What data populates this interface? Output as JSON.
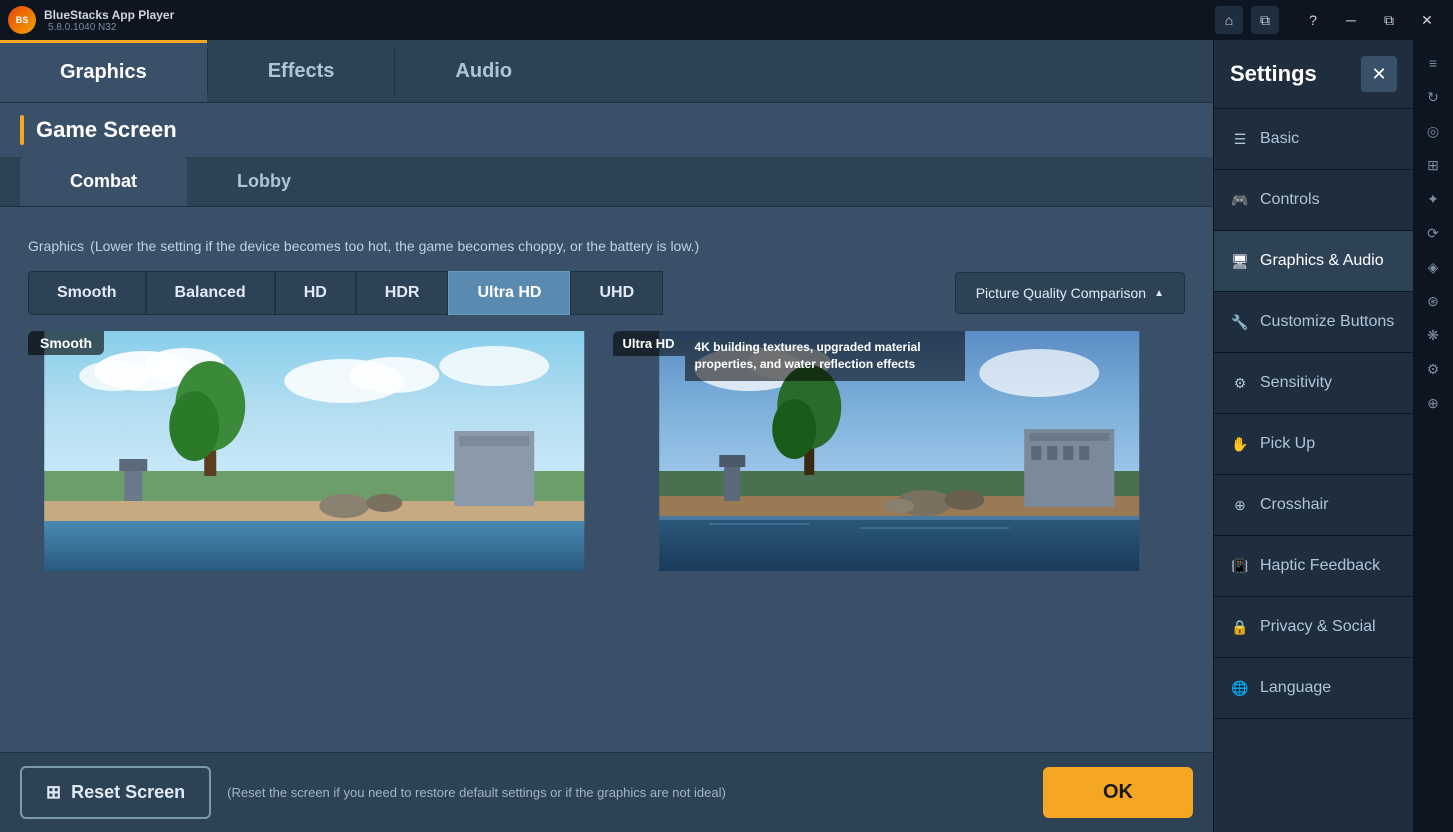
{
  "titlebar": {
    "app_name": "BlueStacks App Player",
    "version": "5.8.0.1040  N32",
    "logo_text": "BS"
  },
  "tabs": {
    "items": [
      {
        "label": "Graphics",
        "active": true
      },
      {
        "label": "Effects",
        "active": false
      },
      {
        "label": "Audio",
        "active": false
      }
    ]
  },
  "section": {
    "title": "Game Screen"
  },
  "sub_tabs": {
    "items": [
      {
        "label": "Combat",
        "active": true
      },
      {
        "label": "Lobby",
        "active": false
      }
    ]
  },
  "graphics": {
    "label": "Graphics",
    "description": "(Lower the setting if the device becomes too hot, the game becomes choppy, or the battery is low.)",
    "quality_buttons": [
      {
        "label": "Smooth",
        "active": false
      },
      {
        "label": "Balanced",
        "active": false
      },
      {
        "label": "HD",
        "active": false
      },
      {
        "label": "HDR",
        "active": false
      },
      {
        "label": "Ultra HD",
        "active": true
      },
      {
        "label": "UHD",
        "active": false
      }
    ],
    "picture_quality_btn": "Picture Quality Comparison",
    "smooth_label": "Smooth",
    "ultra_hd_label": "Ultra HD",
    "ultra_hd_description": "4K building textures, upgraded material properties, and water reflection effects"
  },
  "bottom_bar": {
    "reset_icon": "⊞",
    "reset_label": "Reset Screen",
    "reset_hint": "(Reset the screen if you need to restore default settings or if the graphics are not ideal)",
    "ok_label": "OK"
  },
  "sidebar": {
    "title": "Settings",
    "items": [
      {
        "label": "Basic",
        "active": false,
        "icon": "☰"
      },
      {
        "label": "Controls",
        "active": false,
        "icon": "🎮"
      },
      {
        "label": "Graphics & Audio",
        "active": true,
        "icon": "🖥"
      },
      {
        "label": "Customize Buttons",
        "active": false,
        "icon": "🔧"
      },
      {
        "label": "Sensitivity",
        "active": false,
        "icon": "⚙"
      },
      {
        "label": "Pick Up",
        "active": false,
        "icon": "✋"
      },
      {
        "label": "Crosshair",
        "active": false,
        "icon": "⊕"
      },
      {
        "label": "Haptic Feedback",
        "active": false,
        "icon": "📳"
      },
      {
        "label": "Privacy & Social",
        "active": false,
        "icon": "🔒"
      },
      {
        "label": "Language",
        "active": false,
        "icon": "🌐"
      }
    ]
  }
}
